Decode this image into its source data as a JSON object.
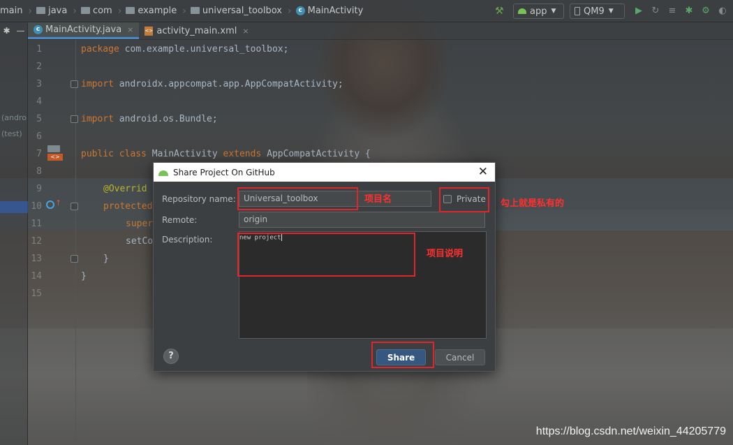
{
  "breadcrumbs": [
    "main",
    "java",
    "com",
    "example",
    "universal_toolbox",
    "MainActivity"
  ],
  "run_config": "app",
  "device": "QM9",
  "tabs": [
    {
      "label": "MainActivity.java",
      "active": true
    },
    {
      "label": "activity_main.xml",
      "active": false
    }
  ],
  "project_panel": {
    "items": [
      "(andro",
      "(test)"
    ]
  },
  "code": {
    "line_numbers": [
      "1",
      "2",
      "3",
      "4",
      "5",
      "6",
      "7",
      "8",
      "9",
      "10",
      "11",
      "12",
      "13",
      "14",
      "15"
    ],
    "lines": [
      {
        "kw": "package",
        "rest": " com.example.universal_toolbox;"
      },
      {
        "kw": "import",
        "rest": " androidx.appcompat.app.AppCompatActivity;"
      },
      {
        "kw": "import",
        "rest": " android.os.Bundle;"
      },
      {
        "kw": "public class",
        "cls": " MainActivity ",
        "kw2": "extends",
        "rest": " AppCompatActivity {"
      },
      {
        "ann": "@Overrid"
      },
      {
        "kw": "protected"
      },
      {
        "kw": "super"
      },
      {
        "plain": "setCo"
      },
      {
        "plain": "}"
      },
      {
        "plain": "}"
      }
    ]
  },
  "dialog": {
    "title": "Share Project On GitHub",
    "repo_label": "Repository name:",
    "repo_value": "Universal_toolbox",
    "private_label": "Private",
    "private_checked": false,
    "remote_label": "Remote:",
    "remote_value": "origin",
    "description_label": "Description:",
    "description_value": "new project",
    "help_label": "?",
    "share_label": "Share",
    "cancel_label": "Cancel"
  },
  "annotations": {
    "repo_note": "项目名",
    "private_note": "勾上就是私有的",
    "desc_note": "项目说明"
  },
  "watermark": "https://blog.csdn.net/weixin_44205779",
  "colors": {
    "annotation_red": "#e0262a",
    "share_button": "#365880"
  }
}
